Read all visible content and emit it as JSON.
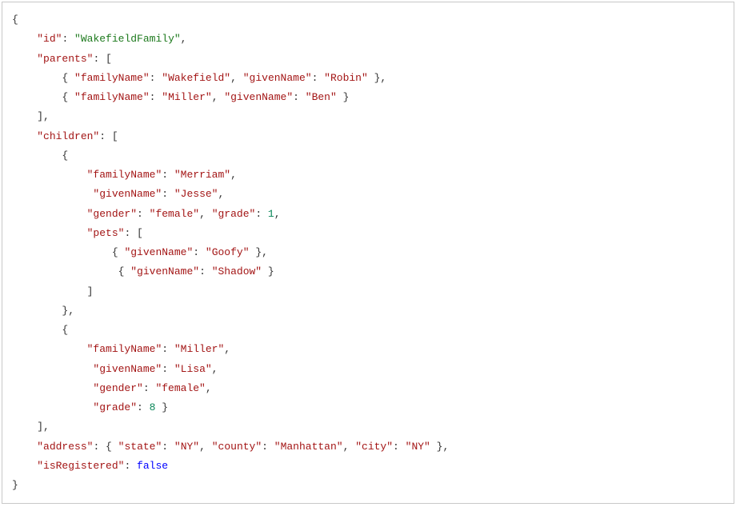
{
  "code": {
    "id_key": "\"id\"",
    "id_val": "\"WakefieldFamily\"",
    "parents_key": "\"parents\"",
    "familyName_key": "\"familyName\"",
    "givenName_key": "\"givenName\"",
    "wakefield": "\"Wakefield\"",
    "robin": "\"Robin\"",
    "miller": "\"Miller\"",
    "ben": "\"Ben\"",
    "children_key": "\"children\"",
    "merriam": "\"Merriam\"",
    "jesse": "\"Jesse\"",
    "gender_key": "\"gender\"",
    "female": "\"female\"",
    "grade_key": "\"grade\"",
    "grade1": "1",
    "pets_key": "\"pets\"",
    "goofy": "\"Goofy\"",
    "shadow": "\"Shadow\"",
    "lisa": "\"Lisa\"",
    "grade8": "8",
    "address_key": "\"address\"",
    "state_key": "\"state\"",
    "ny": "\"NY\"",
    "county_key": "\"county\"",
    "manhattan": "\"Manhattan\"",
    "city_key": "\"city\"",
    "isRegistered_key": "\"isRegistered\"",
    "false_val": "false",
    "brace_open": "{",
    "brace_close": "}",
    "bracket_open": "[",
    "bracket_close": "]",
    "comma": ",",
    "colon": ": "
  }
}
